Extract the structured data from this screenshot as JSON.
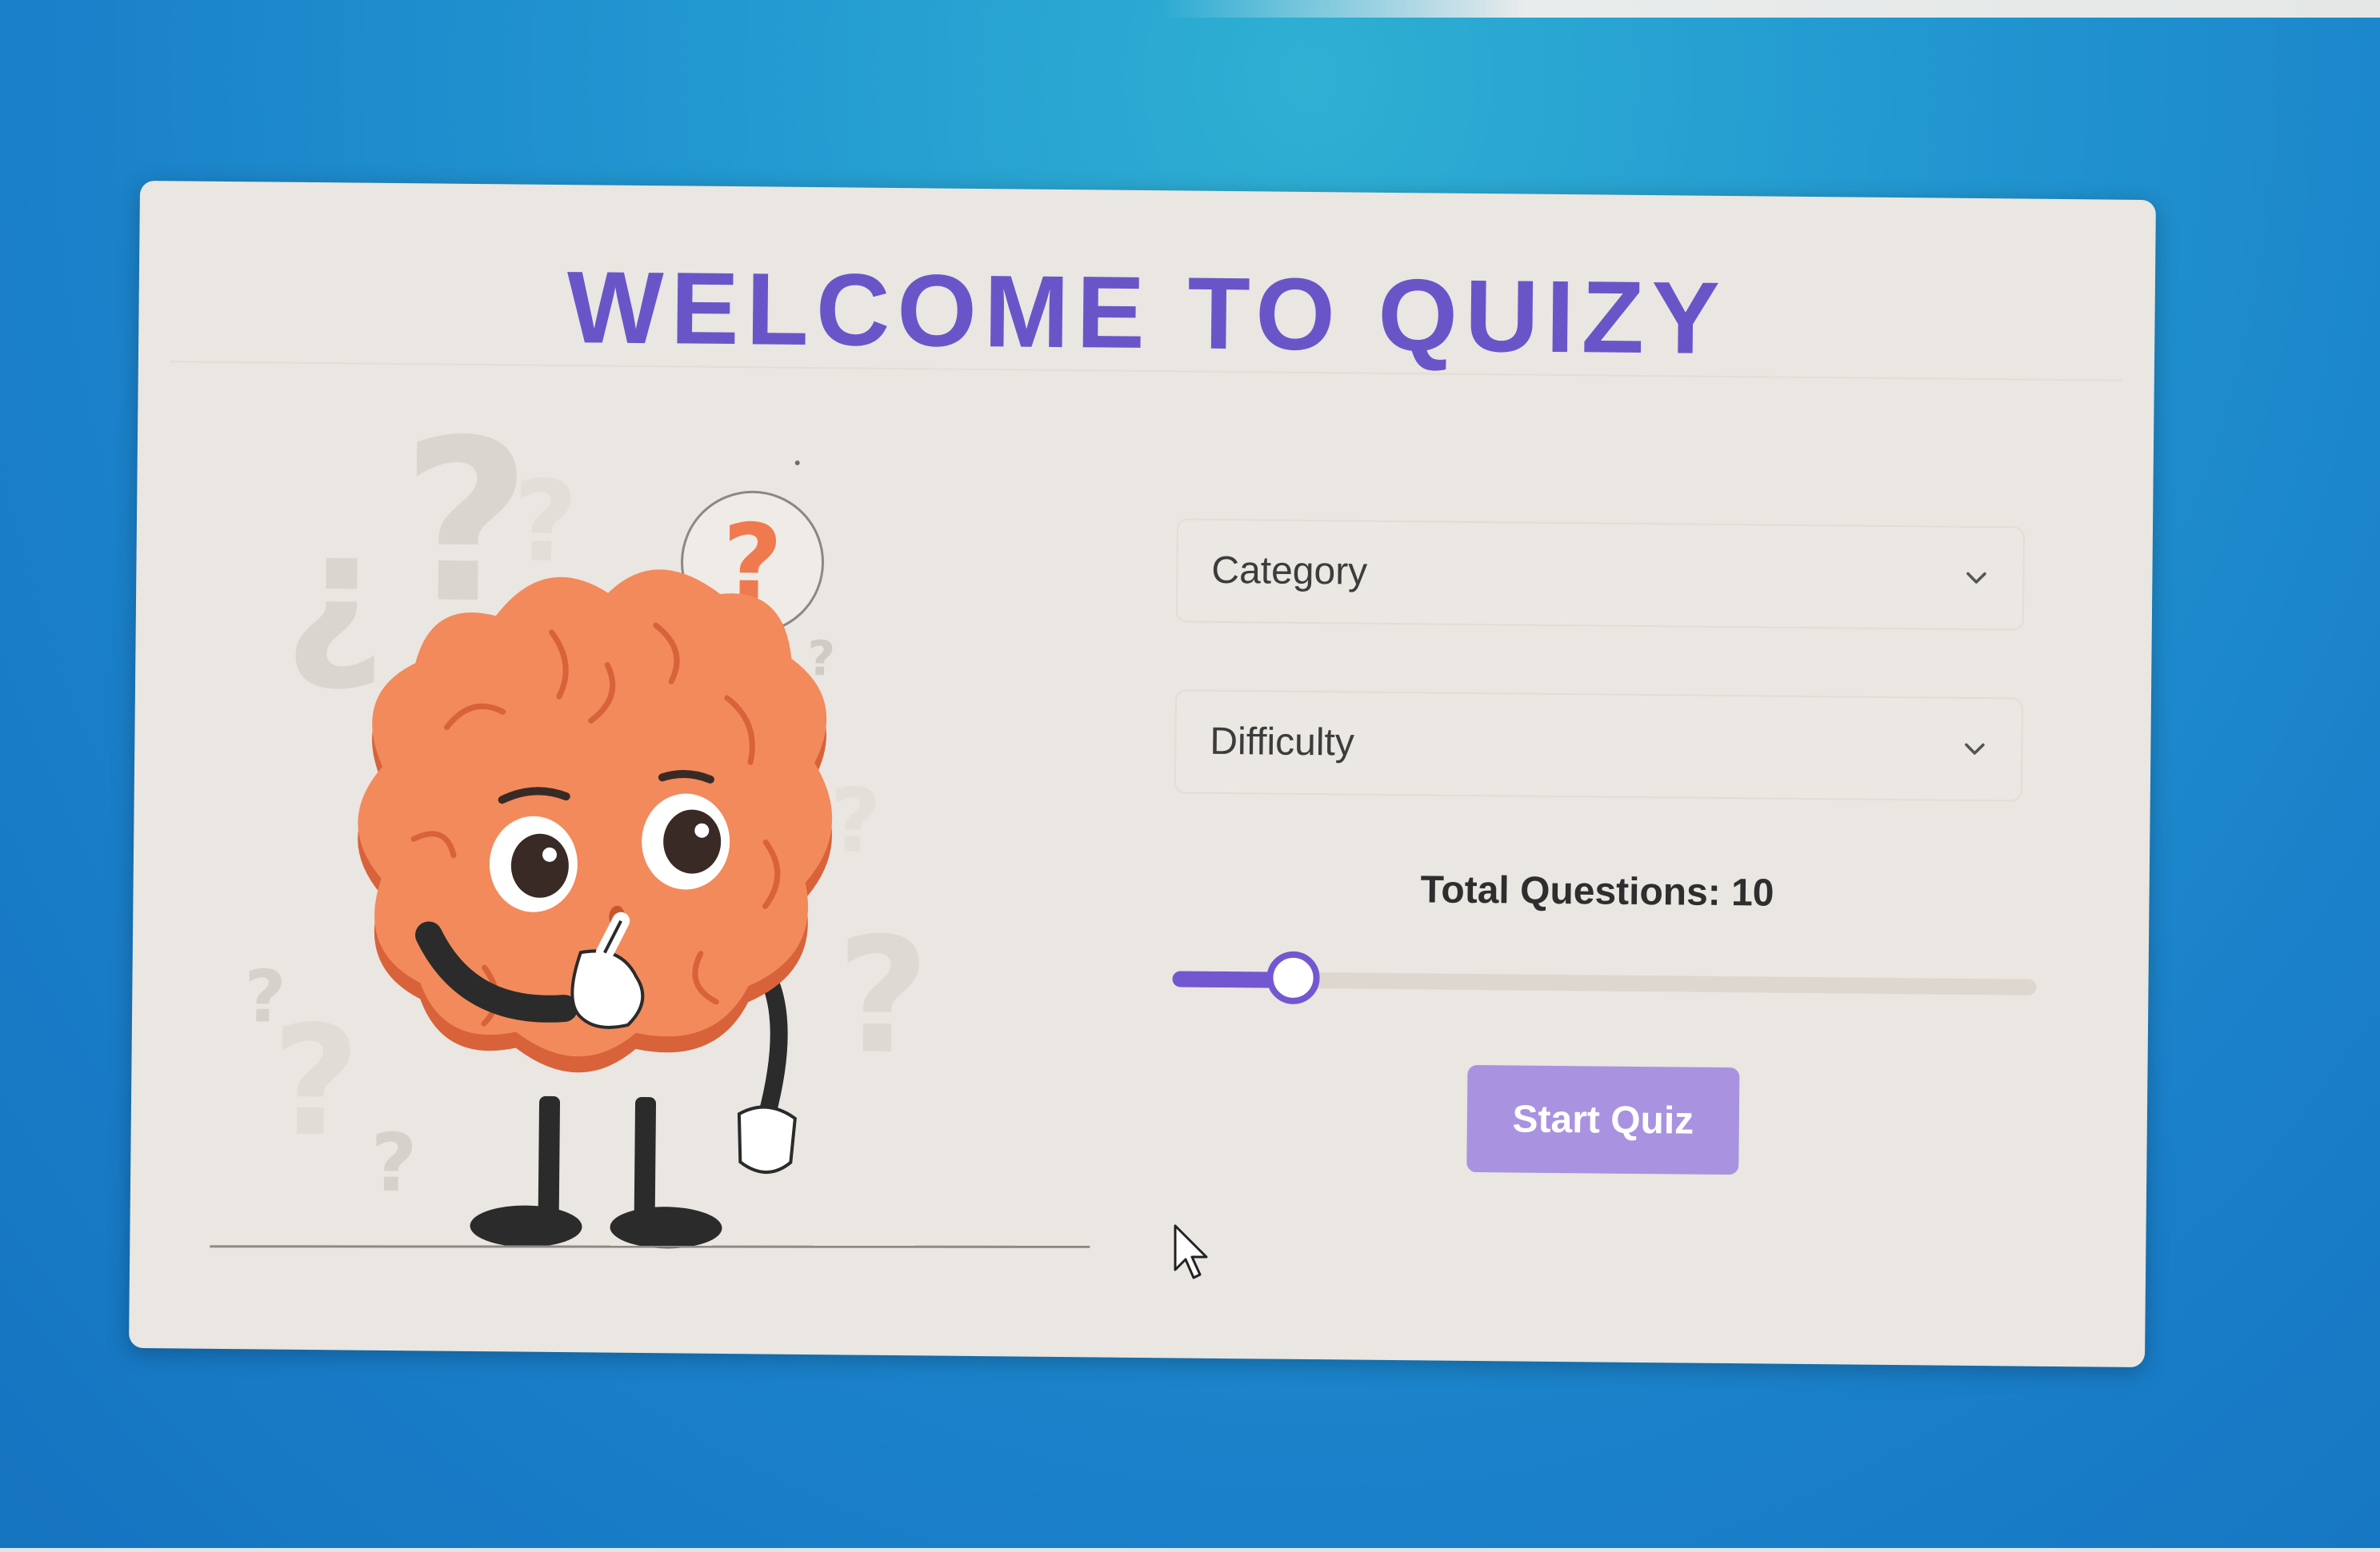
{
  "page": {
    "title": "WELCOME TO QUIZY"
  },
  "form": {
    "category": {
      "placeholder": "Category"
    },
    "difficulty": {
      "placeholder": "Difficulty"
    },
    "total_questions": {
      "label": "Total Questions: 10",
      "value": 10,
      "slider_fraction": 0.14
    },
    "start_button_label": "Start Quiz"
  },
  "icons": {
    "category_chevron": "chevron-down-icon",
    "difficulty_chevron": "chevron-down-icon",
    "illustration": "thinking-brain-illustration",
    "cursor": "mouse-pointer-icon"
  },
  "colors": {
    "accent": "#7357d0",
    "title": "#6a55c8",
    "button": "#a993e0",
    "brain": "#f28a5c",
    "background": "#1f8fce",
    "card": "#eae6e1"
  }
}
